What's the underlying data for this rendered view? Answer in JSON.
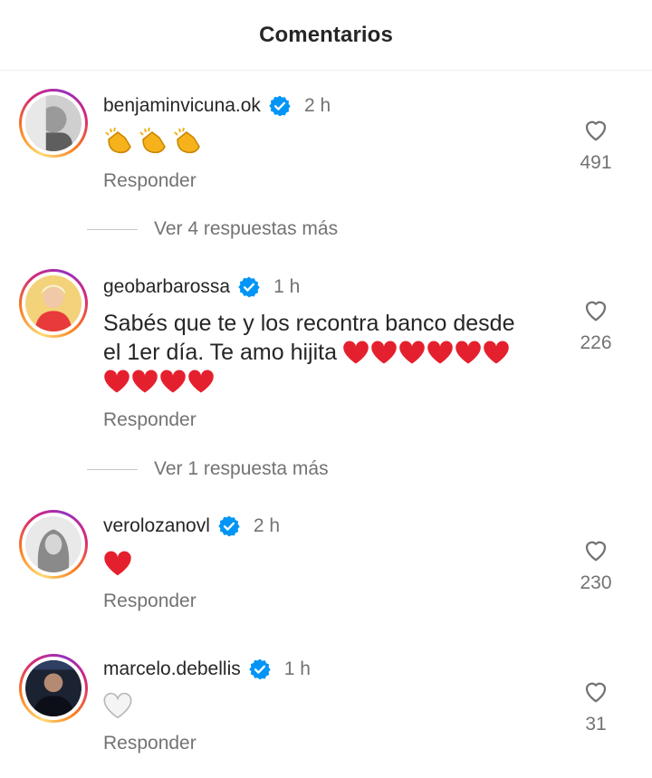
{
  "header": {
    "title": "Comentarios"
  },
  "comments": [
    {
      "username": "benjaminvicuna.ok",
      "verified": true,
      "time": "2 h",
      "text": "",
      "emoji": [
        "clapping-hands",
        "clapping-hands",
        "clapping-hands"
      ],
      "reply_label": "Responder",
      "likes": "491",
      "more_replies": "Ver 4 respuestas más"
    },
    {
      "username": "geobarbarossa",
      "verified": true,
      "time": "1 h",
      "text_line1": "Sabés que te y los recontra banco desde",
      "text_line2": "el 1er día. Te amo hijita",
      "emoji": [
        "red-heart",
        "red-heart",
        "red-heart",
        "red-heart",
        "red-heart",
        "red-heart",
        "red-heart",
        "red-heart",
        "red-heart",
        "red-heart"
      ],
      "reply_label": "Responder",
      "likes": "226",
      "more_replies": "Ver 1 respuesta más"
    },
    {
      "username": "verolozanovl",
      "verified": true,
      "time": "2 h",
      "emoji": [
        "red-heart"
      ],
      "reply_label": "Responder",
      "likes": "230"
    },
    {
      "username": "marcelo.debellis",
      "verified": true,
      "time": "1 h",
      "emoji": [
        "white-heart"
      ],
      "reply_label": "Responder",
      "likes": "31"
    }
  ],
  "colors": {
    "verified_blue": "#0095f6",
    "secondary_text": "#737373",
    "heart_red": "#e5202e"
  }
}
